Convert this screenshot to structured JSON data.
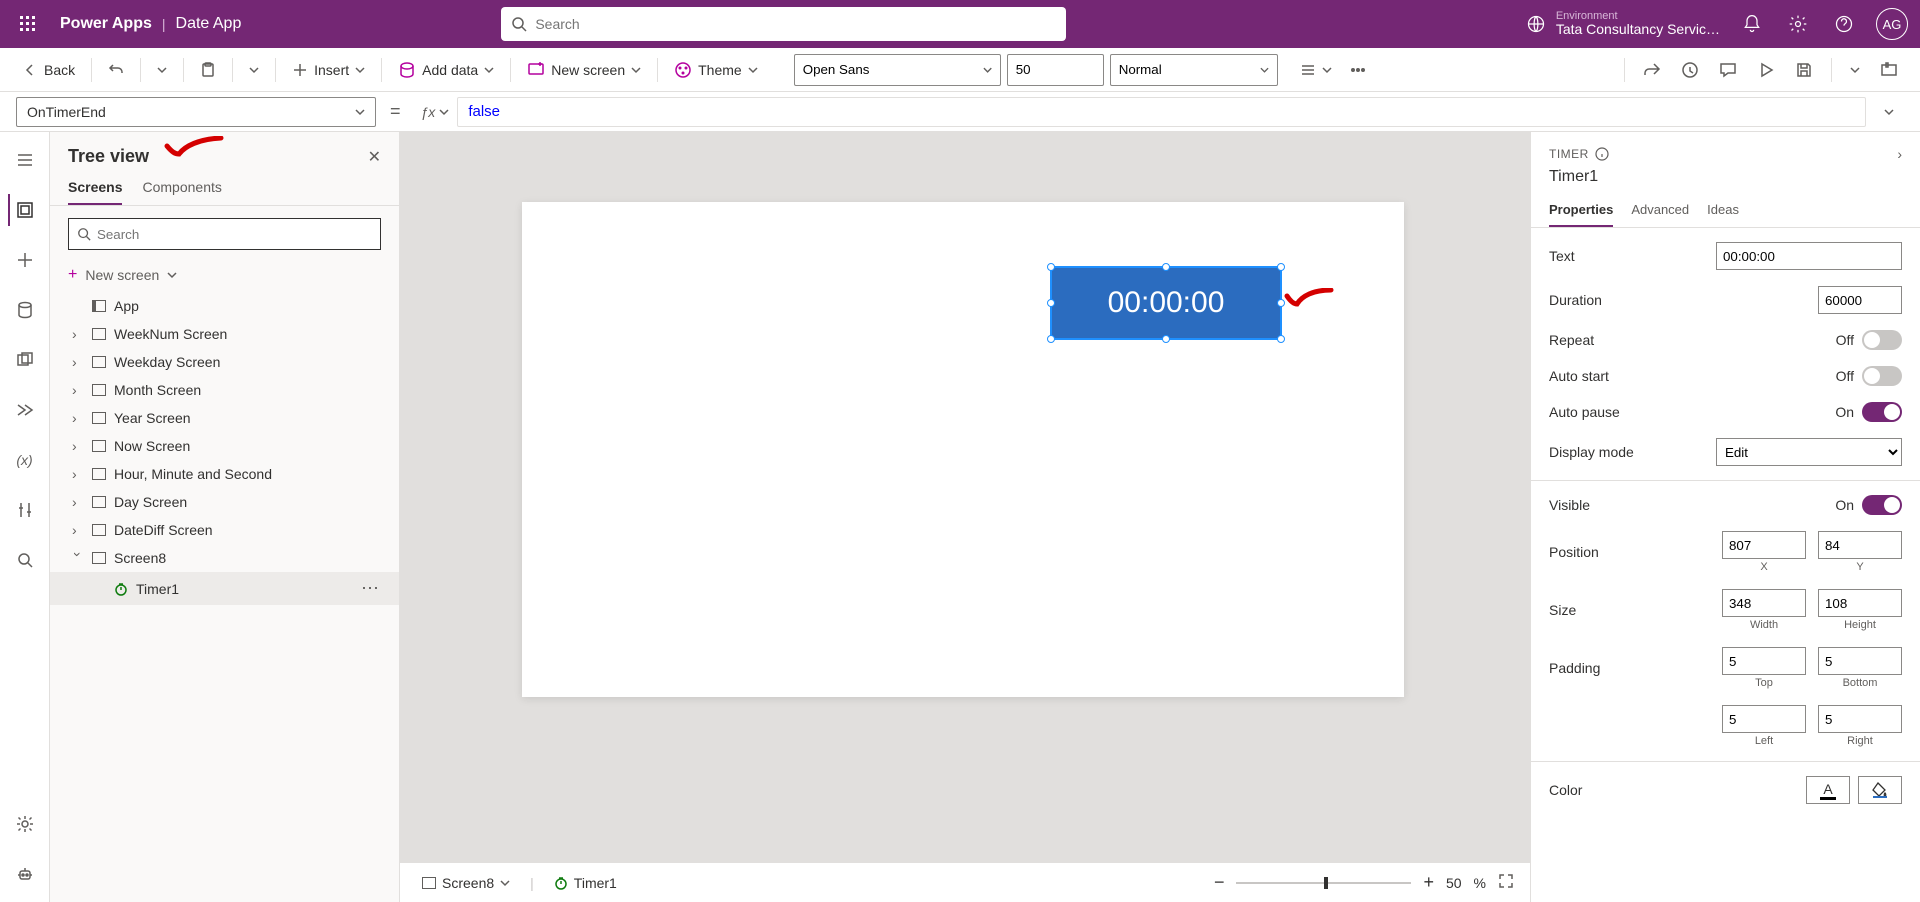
{
  "titlebar": {
    "appName": "Power Apps",
    "subName": "Date App",
    "searchPlaceholder": "Search",
    "envLabel": "Environment",
    "envName": "Tata Consultancy Servic…",
    "avatar": "AG"
  },
  "cmdbar": {
    "back": "Back",
    "insert": "Insert",
    "addData": "Add data",
    "newScreen": "New screen",
    "theme": "Theme",
    "font": "Open Sans",
    "fontSize": "50",
    "fontWeight": "Normal"
  },
  "formulabar": {
    "property": "OnTimerEnd",
    "formula": "false"
  },
  "treeview": {
    "title": "Tree view",
    "tabs": {
      "screens": "Screens",
      "components": "Components"
    },
    "searchPlaceholder": "Search",
    "newScreen": "New screen",
    "app": "App",
    "items": [
      "WeekNum Screen",
      "Weekday Screen",
      "Month Screen",
      "Year Screen",
      "Now Screen",
      "Hour, Minute and Second",
      "Day Screen",
      "DateDiff Screen",
      "Screen8"
    ],
    "selected": "Timer1"
  },
  "canvas": {
    "timerText": "00:00:00"
  },
  "statusbar": {
    "screen": "Screen8",
    "control": "Timer1",
    "zoom": "50",
    "zoomSuffix": "%"
  },
  "props": {
    "type": "TIMER",
    "name": "Timer1",
    "tabs": {
      "properties": "Properties",
      "advanced": "Advanced",
      "ideas": "Ideas"
    },
    "text": {
      "label": "Text",
      "value": "00:00:00"
    },
    "duration": {
      "label": "Duration",
      "value": "60000"
    },
    "repeat": {
      "label": "Repeat",
      "state": "Off"
    },
    "autostart": {
      "label": "Auto start",
      "state": "Off"
    },
    "autopause": {
      "label": "Auto pause",
      "state": "On"
    },
    "displaymode": {
      "label": "Display mode",
      "value": "Edit"
    },
    "visible": {
      "label": "Visible",
      "state": "On"
    },
    "position": {
      "label": "Position",
      "x": "807",
      "y": "84",
      "xlabel": "X",
      "ylabel": "Y"
    },
    "size": {
      "label": "Size",
      "w": "348",
      "h": "108",
      "wlabel": "Width",
      "hlabel": "Height"
    },
    "padding": {
      "label": "Padding",
      "t": "5",
      "b": "5",
      "l": "5",
      "r": "5",
      "tlabel": "Top",
      "blabel": "Bottom",
      "llabel": "Left",
      "rlabel": "Right"
    },
    "color": {
      "label": "Color"
    }
  }
}
